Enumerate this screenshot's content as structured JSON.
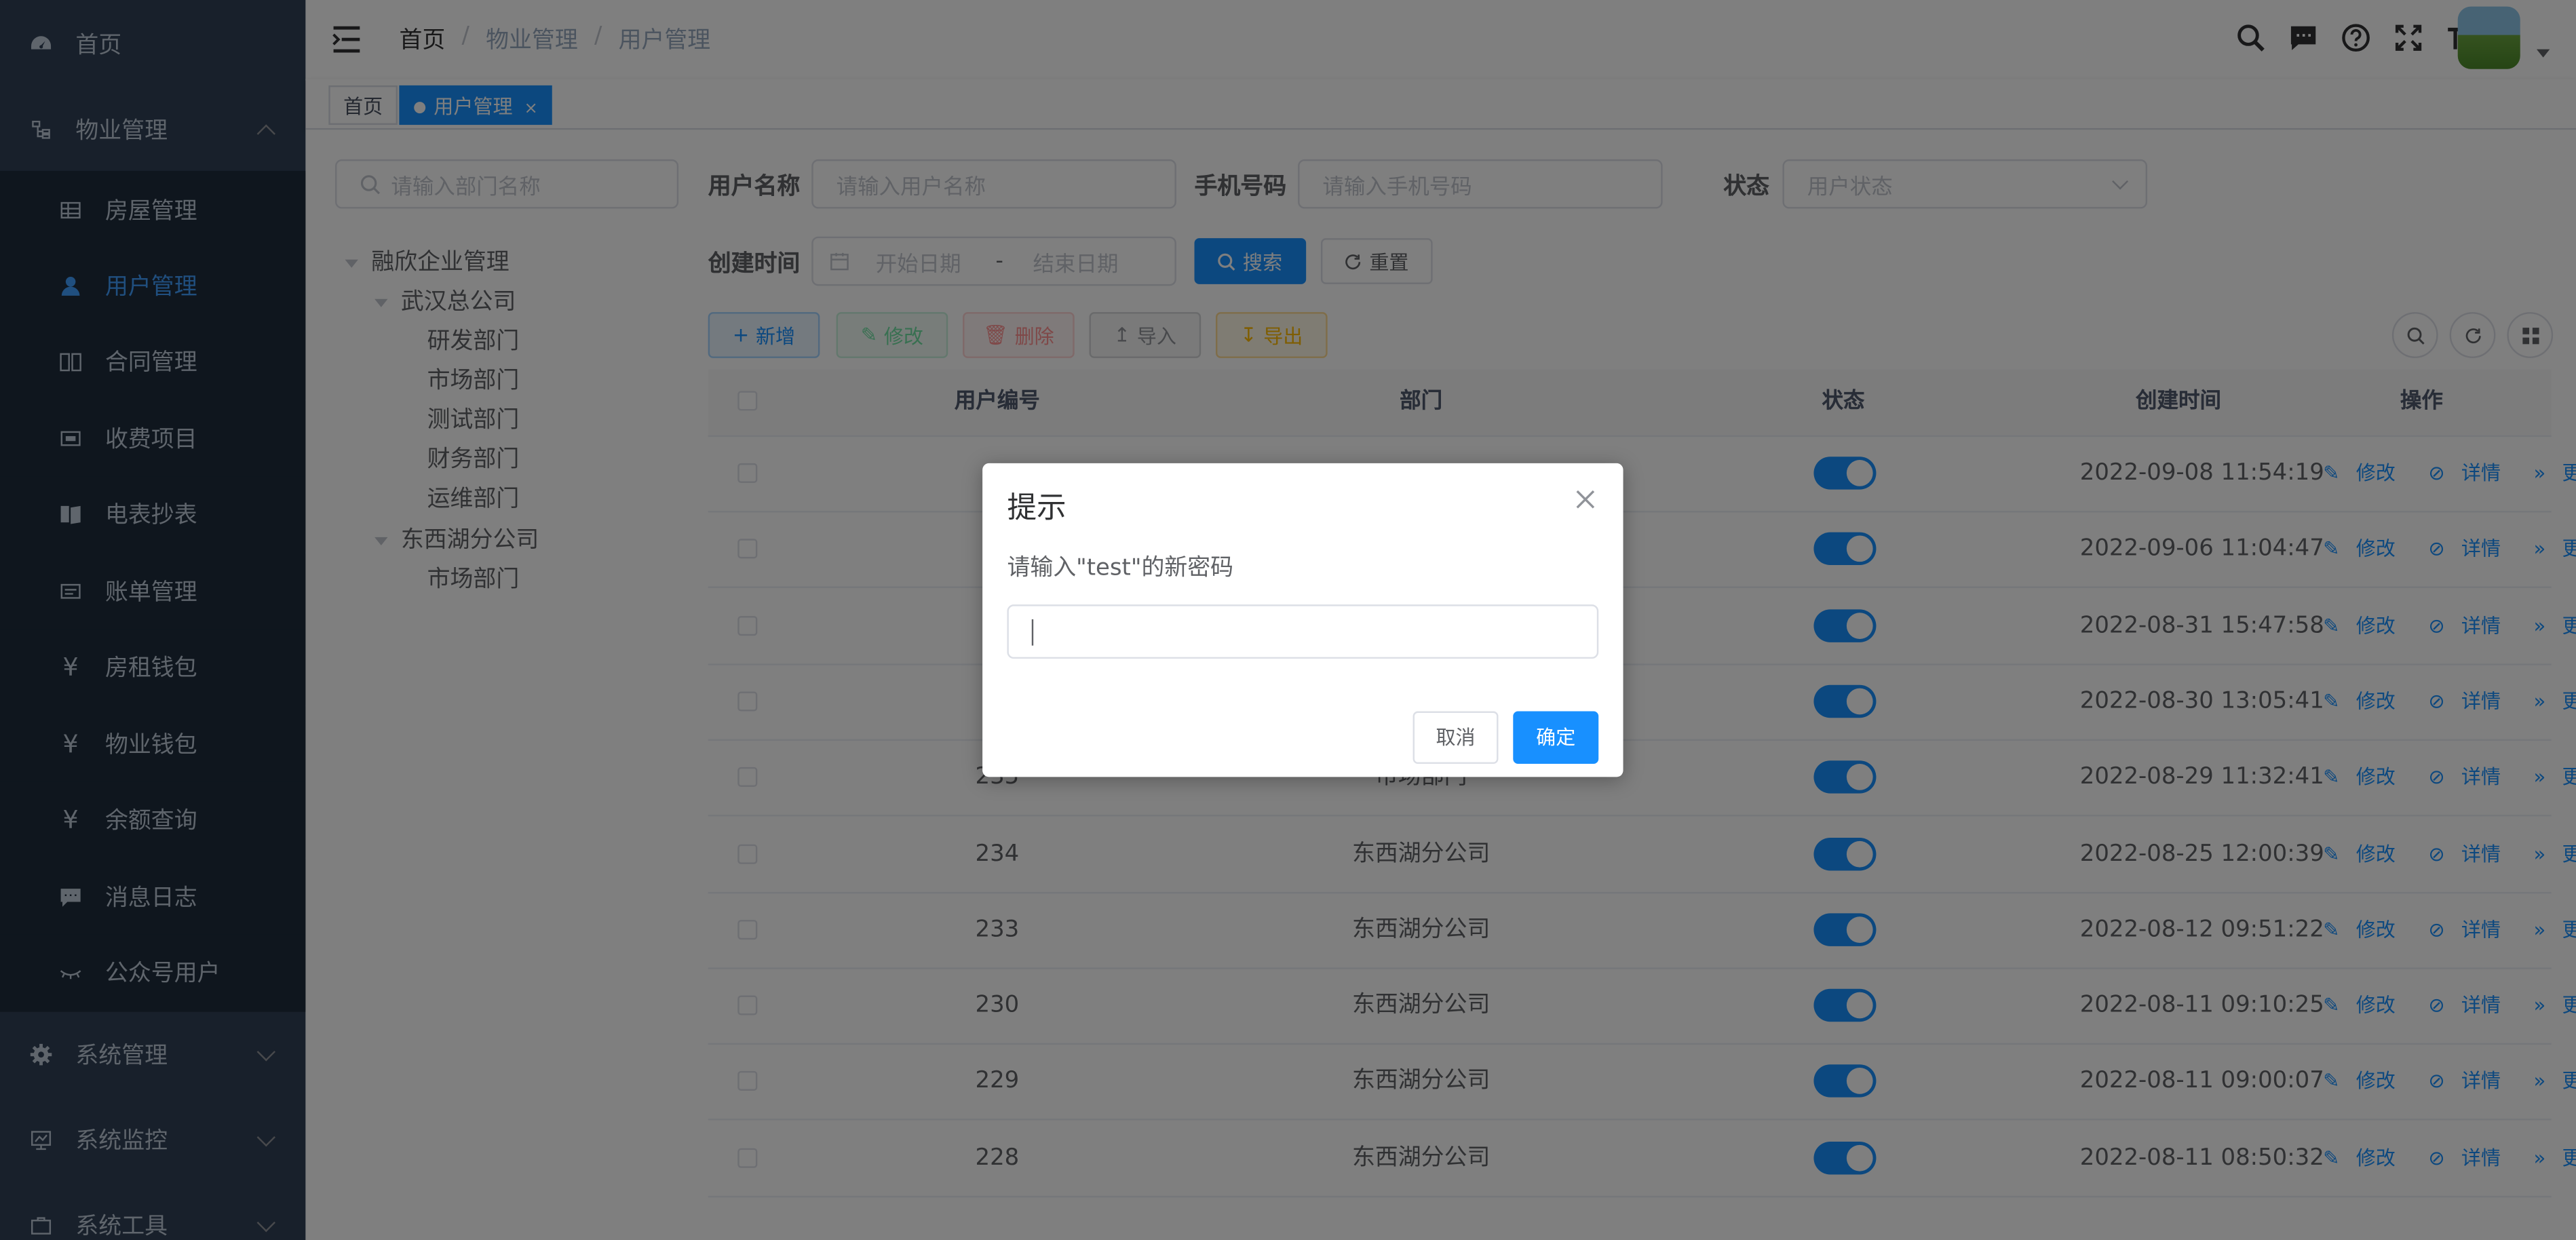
{
  "sidebar": {
    "items": [
      {
        "label": "首页",
        "icon": "dashboard-icon"
      },
      {
        "label": "物业管理",
        "icon": "tree-icon"
      },
      {
        "label": "房屋管理",
        "icon": "table-icon"
      },
      {
        "label": "用户管理",
        "icon": "user-icon"
      },
      {
        "label": "合同管理",
        "icon": "book-icon"
      },
      {
        "label": "收费项目",
        "icon": "money-icon"
      },
      {
        "label": "电表抄表",
        "icon": "meter-icon"
      },
      {
        "label": "账单管理",
        "icon": "bill-icon"
      },
      {
        "label": "房租钱包",
        "icon": "yen-icon"
      },
      {
        "label": "物业钱包",
        "icon": "yen-icon"
      },
      {
        "label": "余额查询",
        "icon": "yen-icon"
      },
      {
        "label": "消息日志",
        "icon": "message-icon"
      },
      {
        "label": "公众号用户",
        "icon": "eye-icon"
      },
      {
        "label": "系统管理",
        "icon": "gear-icon"
      },
      {
        "label": "系统监控",
        "icon": "monitor-icon"
      },
      {
        "label": "系统工具",
        "icon": "tool-icon"
      }
    ]
  },
  "navbar": {
    "breadcrumb": [
      "首页",
      "物业管理",
      "用户管理"
    ]
  },
  "tags": {
    "home": "首页",
    "current": "用户管理",
    "close": "×"
  },
  "dept_search": {
    "placeholder": "请输入部门名称"
  },
  "tree": [
    "融欣企业管理",
    "武汉总公司",
    "研发部门",
    "市场部门",
    "测试部门",
    "财务部门",
    "运维部门",
    "东西湖分公司",
    "市场部门"
  ],
  "filters": {
    "username_label": "用户名称",
    "username_placeholder": "请输入用户名称",
    "phone_label": "手机号码",
    "phone_placeholder": "请输入手机号码",
    "status_label": "状态",
    "status_placeholder": "用户状态",
    "created_label": "创建时间",
    "start_placeholder": "开始日期",
    "range_sep": "-",
    "end_placeholder": "结束日期",
    "search_btn": "搜索",
    "reset_btn": "重置"
  },
  "toolbar": {
    "add": "新增",
    "edit": "修改",
    "delete": "删除",
    "import": "导入",
    "export": "导出"
  },
  "table": {
    "headers": {
      "id": "用户编号",
      "dept": "部门",
      "status": "状态",
      "created": "创建时间",
      "ops": "操作"
    },
    "ops": {
      "edit": "修改",
      "detail": "详情",
      "more": "更多"
    },
    "rows": [
      {
        "id": "",
        "dept": "",
        "created": "2022-09-08 11:54:19"
      },
      {
        "id": "",
        "dept": "",
        "created": "2022-09-06 11:04:47"
      },
      {
        "id": "",
        "dept": "",
        "created": "2022-08-31 15:47:58"
      },
      {
        "id": "",
        "dept": "",
        "created": "2022-08-30 13:05:41"
      },
      {
        "id": "235",
        "dept": "市场部门",
        "created": "2022-08-29 11:32:41"
      },
      {
        "id": "234",
        "dept": "东西湖分公司",
        "created": "2022-08-25 12:00:39"
      },
      {
        "id": "233",
        "dept": "东西湖分公司",
        "created": "2022-08-12 09:51:22"
      },
      {
        "id": "230",
        "dept": "东西湖分公司",
        "created": "2022-08-11 09:10:25"
      },
      {
        "id": "229",
        "dept": "东西湖分公司",
        "created": "2022-08-11 09:00:07"
      },
      {
        "id": "228",
        "dept": "东西湖分公司",
        "created": "2022-08-11 08:50:32"
      }
    ]
  },
  "dialog": {
    "title": "提示",
    "message": "请输入\"test\"的新密码",
    "input_value": "",
    "cancel": "取消",
    "confirm": "确定"
  },
  "colors": {
    "primary": "#1890ff",
    "sidebar_bg": "#304156",
    "submenu_bg": "#1f2d3d"
  }
}
